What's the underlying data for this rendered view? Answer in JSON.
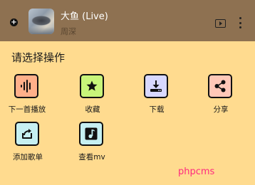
{
  "now_playing": {
    "title": "大鱼 (Live)",
    "artist": "周深",
    "add_icon": "plus-icon",
    "mv_icon": "video-play-icon",
    "more_icon": "more-vertical-icon"
  },
  "sheet": {
    "heading": "请选择操作",
    "actions": [
      {
        "label": "下一首播放",
        "icon": "audio-wave-icon",
        "color": "#ffb08a"
      },
      {
        "label": "收藏",
        "icon": "star-icon",
        "color": "#c8f57a"
      },
      {
        "label": "下载",
        "icon": "download-icon",
        "color": "#d8d8ff"
      },
      {
        "label": "分享",
        "icon": "share-icon",
        "color": "#ffc8b8"
      },
      {
        "label": "添加歌单",
        "icon": "playlist-add-icon",
        "color": "#c6f0f2"
      },
      {
        "label": "查看mv",
        "icon": "music-note-icon",
        "color": "#c6f0f2"
      }
    ]
  },
  "watermark": "phpcms",
  "colors": {
    "background": "#ffdb8f",
    "topbar": "#8e7151",
    "watermark": "#ff2a7f"
  }
}
